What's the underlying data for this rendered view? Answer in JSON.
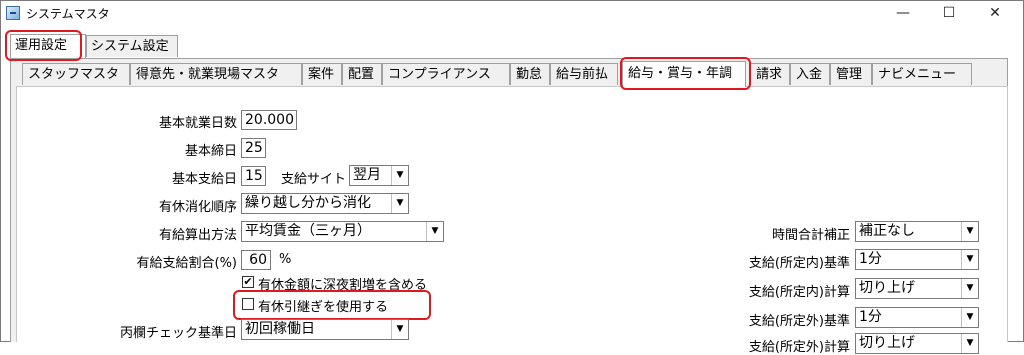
{
  "window": {
    "title": "システムマスタ",
    "minimize": "—",
    "maximize": "☐",
    "close": "✕"
  },
  "main_tabs": [
    "運用設定",
    "システム設定"
  ],
  "sub_tabs": [
    "スタッフマスタ",
    "得意先・就業現場マスタ",
    "案件",
    "配置",
    "コンプライアンス",
    "勤怠",
    "給与前払",
    "給与・賞与・年調",
    "請求",
    "入金",
    "管理",
    "ナビメニュー"
  ],
  "form": {
    "basic_work_days": {
      "label": "基本就業日数",
      "value": "20.000"
    },
    "basic_closing_day": {
      "label": "基本締日",
      "value": "25"
    },
    "basic_pay_day": {
      "label": "基本支給日",
      "value": "15"
    },
    "pay_site": {
      "label": "支給サイト",
      "value": "翌月"
    },
    "paid_leave_order": {
      "label": "有休消化順序",
      "value": "繰り越し分から消化"
    },
    "paid_leave_calc": {
      "label": "有給算出方法",
      "value": "平均賃金（三ヶ月）"
    },
    "paid_leave_rate": {
      "label": "有給支給割合(%)",
      "value": "60",
      "unit": "%"
    },
    "include_night": {
      "label": "有休金額に深夜割増を含める",
      "checked": true,
      "mark": "✔"
    },
    "use_carryover": {
      "label": "有休引継ぎを使用する",
      "checked": false
    },
    "hei_check_basis": {
      "label": "丙欄チェック基準日",
      "value": "初回稼働日"
    },
    "time_total_correction": {
      "label": "時間合計補正",
      "value": "補正なし"
    },
    "pay_within_basis": {
      "label": "支給(所定内)基準",
      "value": "1分"
    },
    "pay_within_calc": {
      "label": "支給(所定内)計算",
      "value": "切り上げ"
    },
    "pay_outside_basis": {
      "label": "支給(所定外)基準",
      "value": "1分"
    },
    "pay_outside_calc": {
      "label": "支給(所定外)計算",
      "value": "切り上げ"
    }
  },
  "highlight_color": "#e0191e"
}
